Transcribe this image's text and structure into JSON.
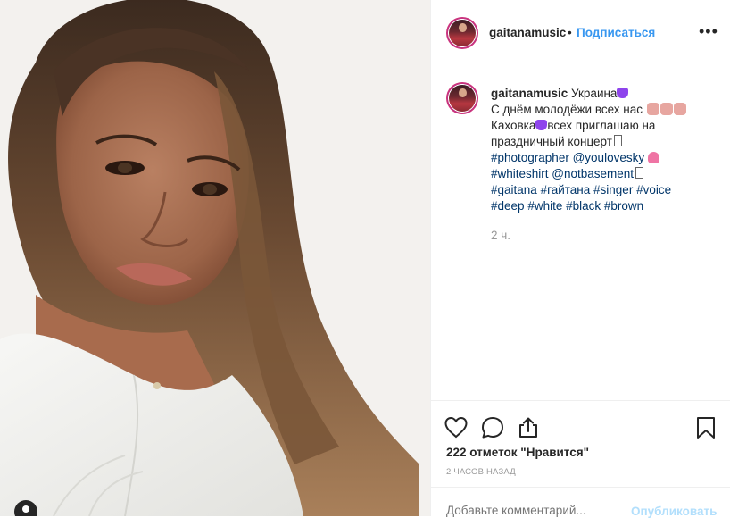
{
  "post": {
    "username": "gaitanamusic",
    "separator": "•",
    "follow_label": "Подписаться",
    "more_label": "•••"
  },
  "caption": {
    "username": "gaitanamusic",
    "line1": "Украина",
    "line2": "С днём молодёжи всех нас",
    "line3a": "Каховка",
    "line3b": "всех приглашаю на",
    "line4": "праздничный концерт",
    "tag_photographer": "#photographer",
    "mention_youlovesky": "@youlovesky",
    "tag_whiteshirt": "#whiteshirt",
    "mention_notbasement": "@notbasement",
    "tag_gaitana": "#gaitana",
    "tag_gaitana_ru": "#гайтана",
    "tag_singer": "#singer",
    "tag_voice": "#voice",
    "tag_deep": "#deep",
    "tag_white": "#white",
    "tag_black": "#black",
    "tag_brown": "#brown",
    "time": "2 ч."
  },
  "actions": {
    "like_icon": "heart-icon",
    "comment_icon": "comment-bubble-icon",
    "share_icon": "share-icon",
    "save_icon": "bookmark-icon",
    "likes_text": "222 отметок \"Нравится\"",
    "post_time": "2 ЧАСОВ НАЗАД"
  },
  "comment": {
    "placeholder": "Добавьте комментарий...",
    "publish_label": "Опубликовать"
  },
  "colors": {
    "accent": "#3897f0",
    "hashtag": "#003569",
    "publish_disabled": "#b2dffc",
    "muted": "#999999"
  }
}
